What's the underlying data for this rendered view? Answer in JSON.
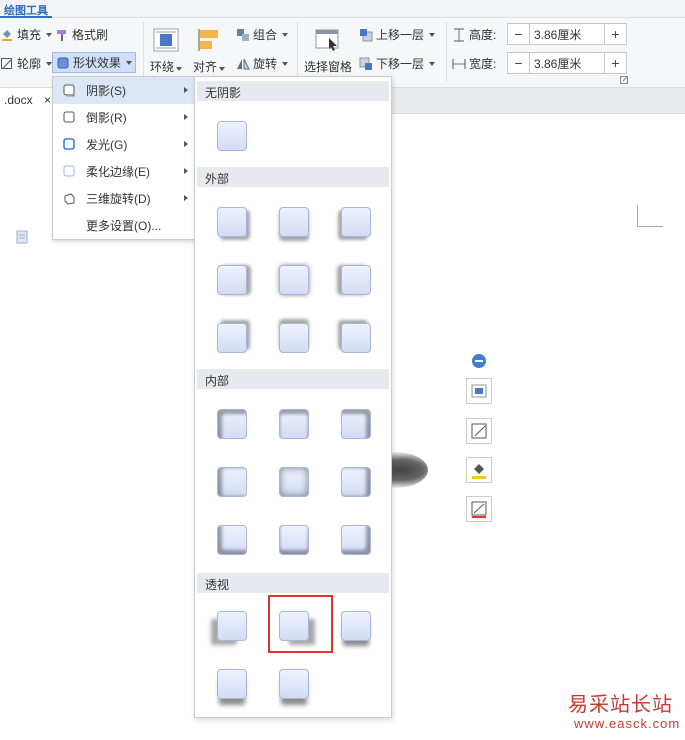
{
  "ribbon": {
    "active_tab": "绘图工具",
    "fill": "填充",
    "format_painter": "格式刷",
    "outline": "轮廓",
    "shape_effects": "形状效果",
    "wrap": "环绕",
    "align": "对齐",
    "group": "组合",
    "rotate": "旋转",
    "select_pane": "选择窗格",
    "bring_forward": "上移一层",
    "send_backward": "下移一层",
    "height_label": "高度:",
    "height_value": "3.86厘米",
    "width_label": "宽度:",
    "width_value": "3.86厘米",
    "minus": "−",
    "plus": "+"
  },
  "doc_tab": {
    "name": ".docx",
    "partial": "×"
  },
  "effects_menu": {
    "items": [
      {
        "label": "阴影(S)",
        "icon": "shadow-icon",
        "submenu": true
      },
      {
        "label": "倒影(R)",
        "icon": "reflection-icon",
        "submenu": true
      },
      {
        "label": "发光(G)",
        "icon": "glow-icon",
        "submenu": true
      },
      {
        "label": "柔化边缘(E)",
        "icon": "soft-edge-icon",
        "submenu": true
      },
      {
        "label": "三维旋转(D)",
        "icon": "3d-rotate-icon",
        "submenu": true
      },
      {
        "label": "更多设置(O)...",
        "icon": "",
        "submenu": false
      }
    ]
  },
  "shadow_gallery": {
    "sections": [
      {
        "title": "无阴影",
        "count": 1
      },
      {
        "title": "外部",
        "count": 9
      },
      {
        "title": "内部",
        "count": 9
      },
      {
        "title": "透视",
        "count": 5
      }
    ],
    "highlighted": "透视 2"
  },
  "float_toolbar": [
    "collapse-icon",
    "shape-style-icon",
    "shape-fill-icon",
    "fill-bucket-icon",
    "outline-icon"
  ],
  "watermark": {
    "line1": "易采站长站",
    "line2": "www.easck.com"
  },
  "colors": {
    "accent": "#2f6fbf",
    "highlight_box": "#e0362c",
    "menu_hover": "#dbe7f7",
    "watermark": "#c83a31"
  }
}
